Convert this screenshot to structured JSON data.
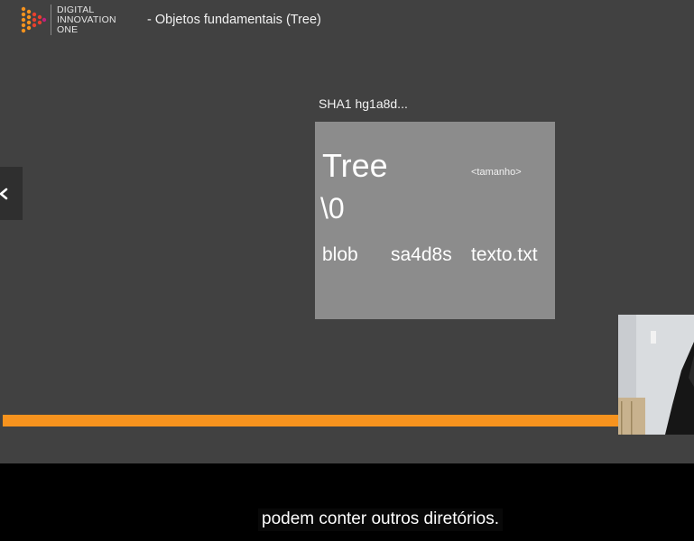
{
  "header": {
    "brand_lines": [
      "DIGITAL",
      "INNOVATION",
      "ONE"
    ],
    "lesson_title": "- Objetos fundamentais (Tree)"
  },
  "slide": {
    "sha_label": "SHA1 hg1a8d...",
    "tree_title": "Tree",
    "size_placeholder": "<tamanho>",
    "null_terminator": "\\0",
    "entry": {
      "type": "blob",
      "hash": "sa4d8s",
      "name": "texto.txt"
    }
  },
  "controls": {
    "back_icon": "chevron-left-icon"
  },
  "player": {
    "caption": "podem conter outros diretórios.",
    "progress_fraction": 0.9,
    "accent_color": "#f7931e"
  }
}
